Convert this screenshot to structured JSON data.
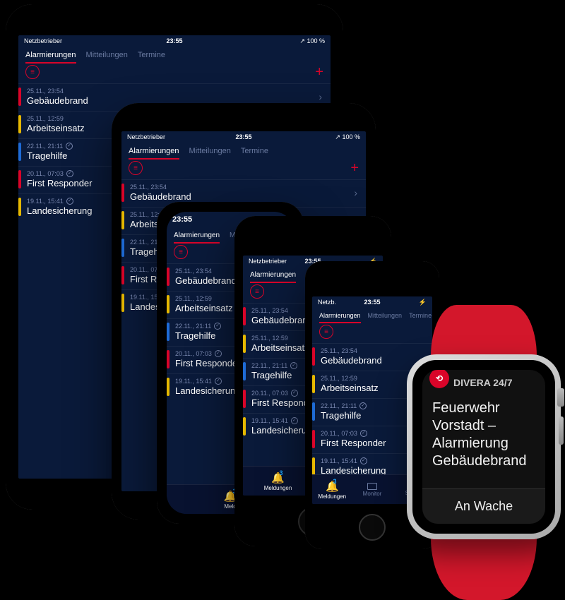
{
  "status": {
    "carrier": "Netzbetrieber",
    "time": "23:55",
    "battery": "100 %",
    "loc_icon": "↗"
  },
  "tabs": {
    "alarm": "Alarmierungen",
    "mitt": "Mitteilungen",
    "term": "Termine"
  },
  "alerts": [
    {
      "ts": "25.11., 23:54",
      "title": "Gebäudebrand",
      "color": "#d90429"
    },
    {
      "ts": "25.11., 12:59",
      "title": "Arbeitseinsatz",
      "color": "#e6b800"
    },
    {
      "ts": "22.11., 21:11",
      "title": "Tragehilfe",
      "color": "#1e6bd6",
      "check": true
    },
    {
      "ts": "20.11., 07:03",
      "title": "First Responder",
      "color": "#d90429",
      "check": true
    },
    {
      "ts": "19.11., 15:41",
      "title": "Landesicherung",
      "color": "#e6b800",
      "check": true
    }
  ],
  "alerts_short3": [
    {
      "ts": "25.11., 23:54",
      "title": "Gebäudebrand",
      "color": "#1aa84c"
    },
    {
      "ts": "25.11., 12:59",
      "title": "Arbeitseinsatz",
      "color": "#e6b800"
    },
    {
      "ts": "22.11., 21:11",
      "title": "Tragehilfe",
      "color": "#1e6bd6",
      "check": true
    }
  ],
  "bottombar": {
    "meld": "Meldungen",
    "monitor": "Monitor",
    "status": "Status",
    "badge": "3"
  },
  "watch": {
    "app": "DIVERA 24/7",
    "body": "Feuerwehr Vorstadt – Alarmierung Gebäudebrand",
    "button": "An Wache"
  }
}
